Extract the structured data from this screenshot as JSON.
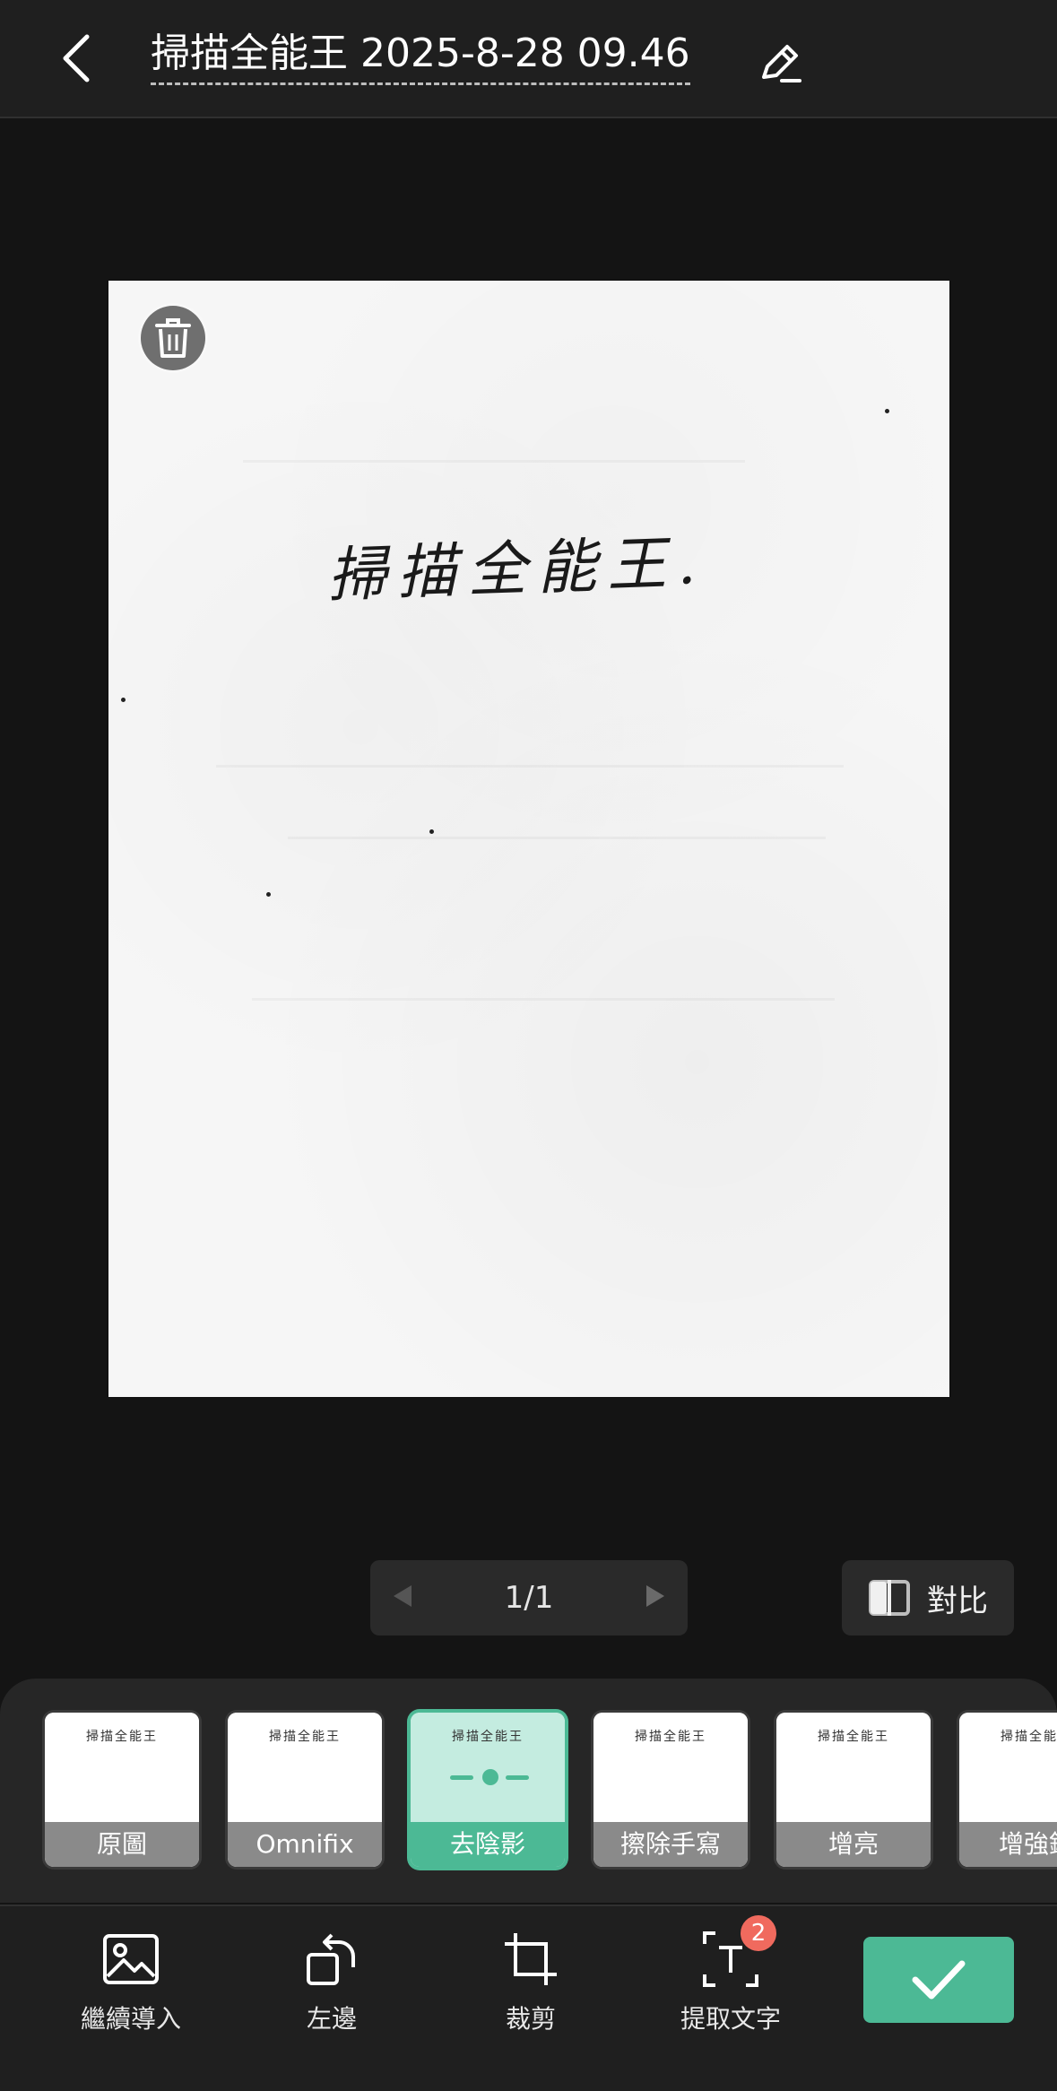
{
  "header": {
    "title": "掃描全能王 2025-8-28 09.46"
  },
  "document": {
    "handwriting": "掃描全能王."
  },
  "pager": {
    "count": "1/1"
  },
  "compare": {
    "label": "對比"
  },
  "filters": [
    {
      "label": "原圖",
      "preview": "掃描全能王"
    },
    {
      "label": "Omnifix",
      "preview": "掃描全能王"
    },
    {
      "label": "去陰影",
      "preview": "掃描全能王",
      "active": true
    },
    {
      "label": "擦除手寫",
      "preview": "掃描全能王"
    },
    {
      "label": "增亮",
      "preview": "掃描全能王"
    },
    {
      "label": "增強銳",
      "preview": "掃描全能王"
    }
  ],
  "toolbar": {
    "import_label": "繼續導入",
    "rotate_label": "左邊",
    "crop_label": "裁剪",
    "extract_label": "提取文字",
    "extract_badge": "2"
  },
  "colors": {
    "accent": "#4cb995",
    "badge": "#f06a5e",
    "background": "#141414"
  }
}
